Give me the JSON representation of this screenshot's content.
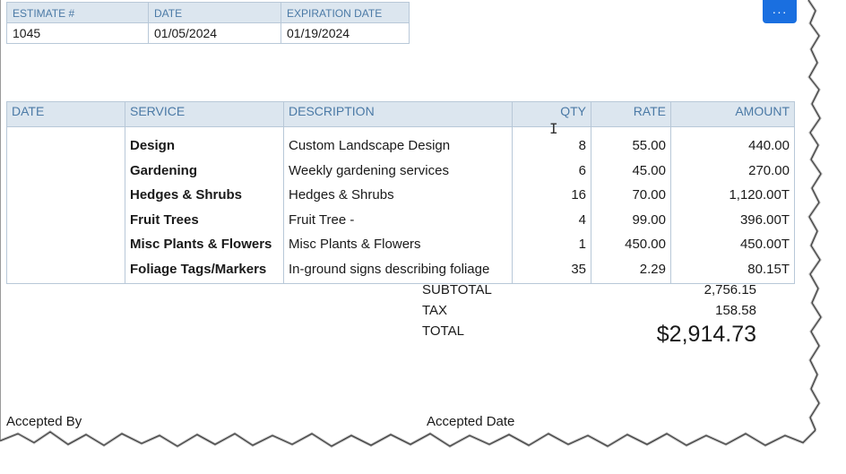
{
  "header": {
    "columns": [
      "ESTIMATE #",
      "DATE",
      "EXPIRATION DATE"
    ],
    "values": [
      "1045",
      "01/05/2024",
      "01/19/2024"
    ]
  },
  "more_button": {
    "label": "···",
    "icon": "ellipsis-icon",
    "color": "#1a6fe0"
  },
  "items": {
    "columns": {
      "date": "DATE",
      "service": "SERVICE",
      "description": "DESCRIPTION",
      "qty": "QTY",
      "rate": "RATE",
      "amount": "AMOUNT"
    },
    "rows": [
      {
        "date": "",
        "service": "Design",
        "description": "Custom Landscape Design",
        "qty": "8",
        "rate": "55.00",
        "amount": "440.00"
      },
      {
        "date": "",
        "service": "Gardening",
        "description": "Weekly gardening services",
        "qty": "6",
        "rate": "45.00",
        "amount": "270.00"
      },
      {
        "date": "",
        "service": "Hedges & Shrubs",
        "description": "Hedges & Shrubs",
        "qty": "16",
        "rate": "70.00",
        "amount": "1,120.00T"
      },
      {
        "date": "",
        "service": "Fruit Trees",
        "description": "Fruit Tree -",
        "qty": "4",
        "rate": "99.00",
        "amount": "396.00T"
      },
      {
        "date": "",
        "service": "Misc Plants & Flowers",
        "description": "Misc Plants & Flowers",
        "qty": "1",
        "rate": "450.00",
        "amount": "450.00T"
      },
      {
        "date": "",
        "service": "Foliage Tags/Markers",
        "description": "In-ground signs describing foliage",
        "qty": "35",
        "rate": "2.29",
        "amount": "80.15T"
      }
    ]
  },
  "totals": {
    "subtotal_label": "SUBTOTAL",
    "subtotal_value": "2,756.15",
    "tax_label": "TAX",
    "tax_value": "158.58",
    "total_label": "TOTAL",
    "total_value": "$2,914.73"
  },
  "footer": {
    "accepted_by": "Accepted By",
    "accepted_date": "Accepted Date"
  },
  "colors": {
    "header_bg": "#dce6ef",
    "header_text": "#4b7aa6",
    "border": "#b8c8d8"
  }
}
